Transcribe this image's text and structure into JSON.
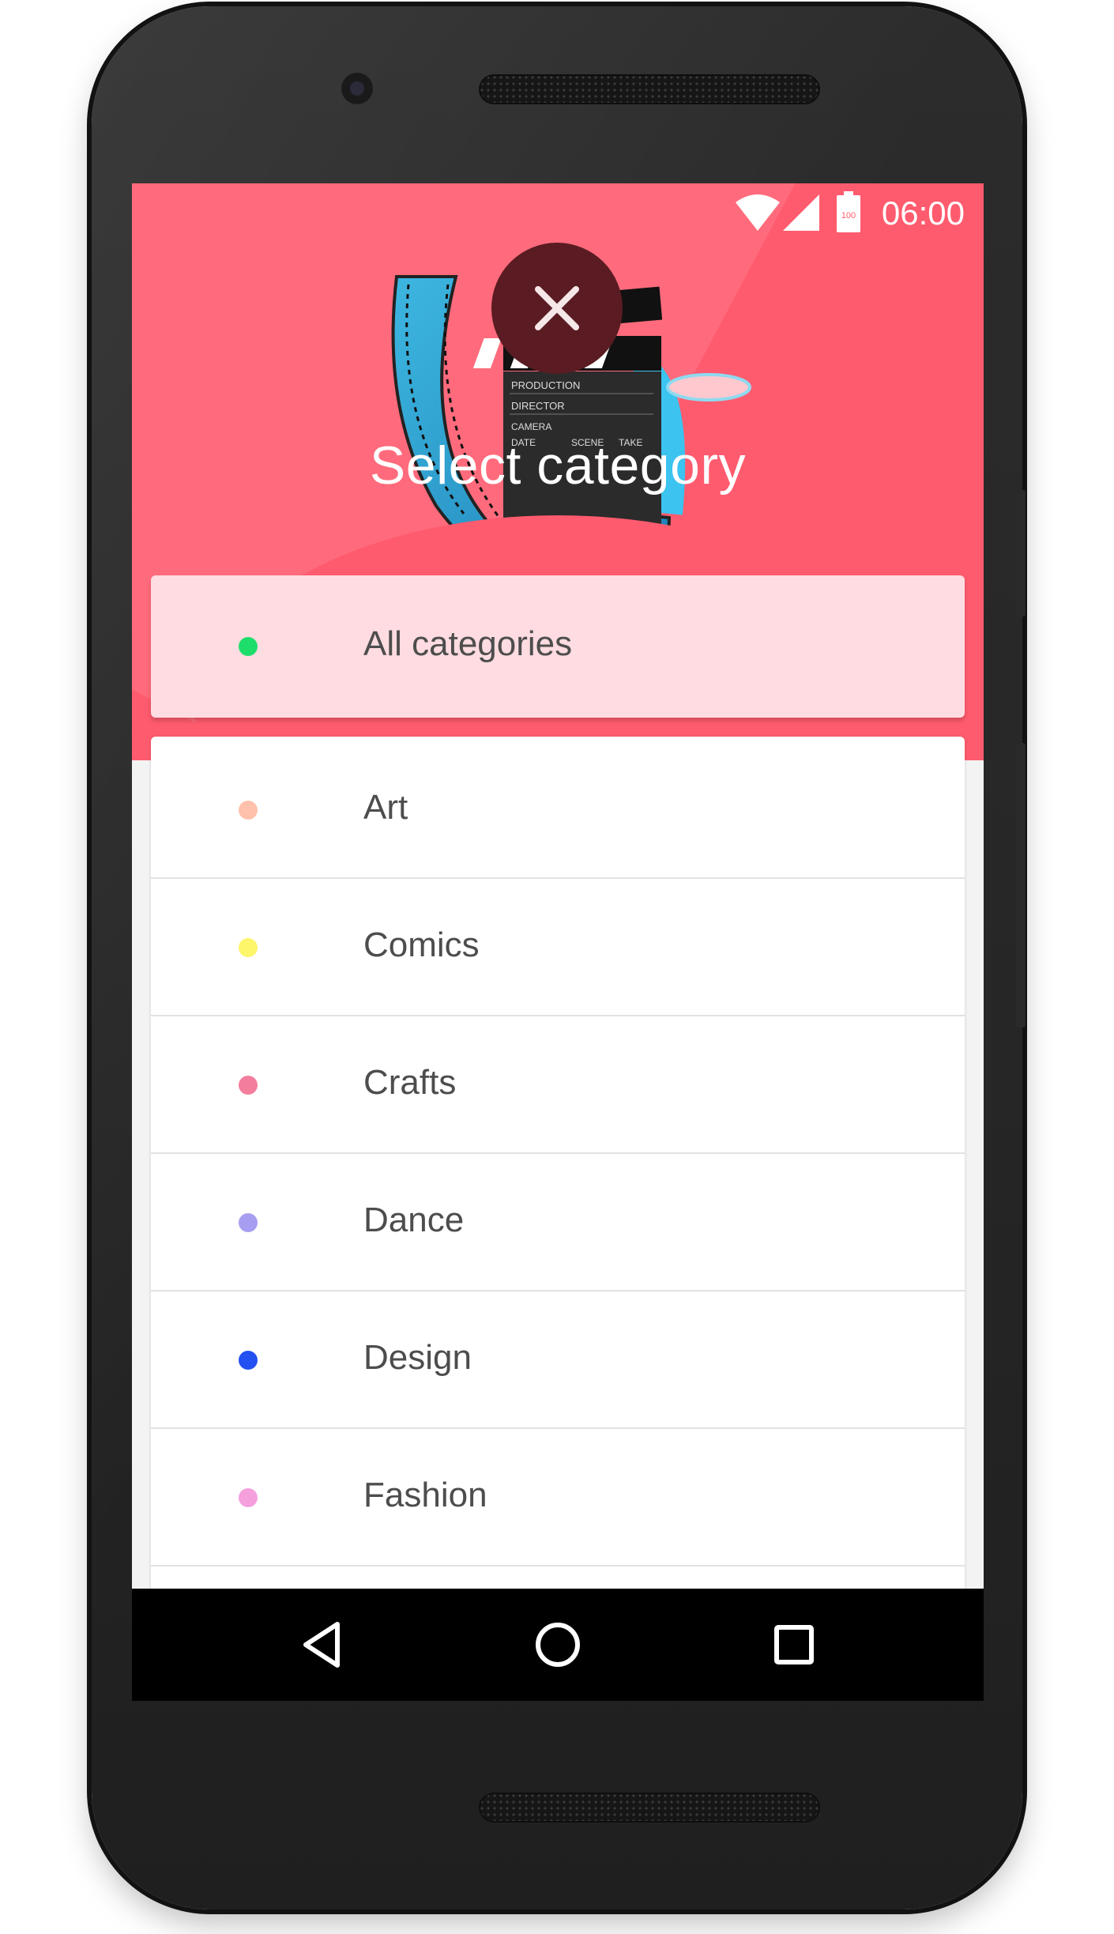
{
  "status_bar": {
    "time": "06:00",
    "battery_level": "100",
    "icons": [
      "wifi-icon",
      "cell-signal-icon",
      "battery-icon"
    ]
  },
  "header": {
    "title": "Select category",
    "close_icon": "close-icon",
    "hero_image": "film-reel-clapperboard",
    "clapperboard_text": [
      "PRODUCTION",
      "DIRECTOR",
      "CAMERA",
      "DATE",
      "SCENE",
      "TAKE"
    ],
    "background_color": "#ff5b6e"
  },
  "categories": [
    {
      "label": "All categories",
      "dot_color": "#1ede6b",
      "selected": true
    },
    {
      "label": "Art",
      "dot_color": "#ffc1ab",
      "selected": false
    },
    {
      "label": "Comics",
      "dot_color": "#fdf56a",
      "selected": false
    },
    {
      "label": "Crafts",
      "dot_color": "#f37d9c",
      "selected": false
    },
    {
      "label": "Dance",
      "dot_color": "#a79ef2",
      "selected": false
    },
    {
      "label": "Design",
      "dot_color": "#2350f0",
      "selected": false
    },
    {
      "label": "Fashion",
      "dot_color": "#f5a0dd",
      "selected": false
    }
  ],
  "nav_bar": {
    "icons": [
      "back-icon",
      "home-icon",
      "recents-icon"
    ]
  }
}
